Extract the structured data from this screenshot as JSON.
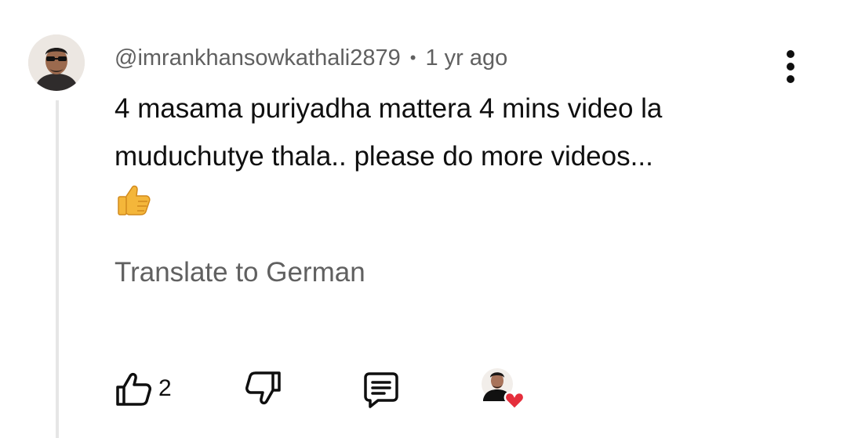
{
  "comment": {
    "author": "@imrankhansowkathali2879",
    "separator": "•",
    "timestamp": "1 yr ago",
    "text_lines": [
      "4 masama puriyadha mattera 4 mins video la",
      "muduchutye thala.. please do more videos..."
    ],
    "emoji": "thumbs-up-emoji",
    "translate_label": "Translate to German"
  },
  "actions": {
    "like_icon": "thumbs-up-icon",
    "like_count": "2",
    "dislike_icon": "thumbs-down-icon",
    "reply_icon": "comment-icon",
    "creator_heart_icon": "creator-heart-icon"
  },
  "menu": {
    "icon": "more-vert-icon"
  },
  "colors": {
    "text_primary": "#0f0f0f",
    "text_secondary": "#606060",
    "thread_line": "#e6e6e6",
    "heart": "#e52e3c",
    "emoji_yellow": "#f4b63a"
  }
}
